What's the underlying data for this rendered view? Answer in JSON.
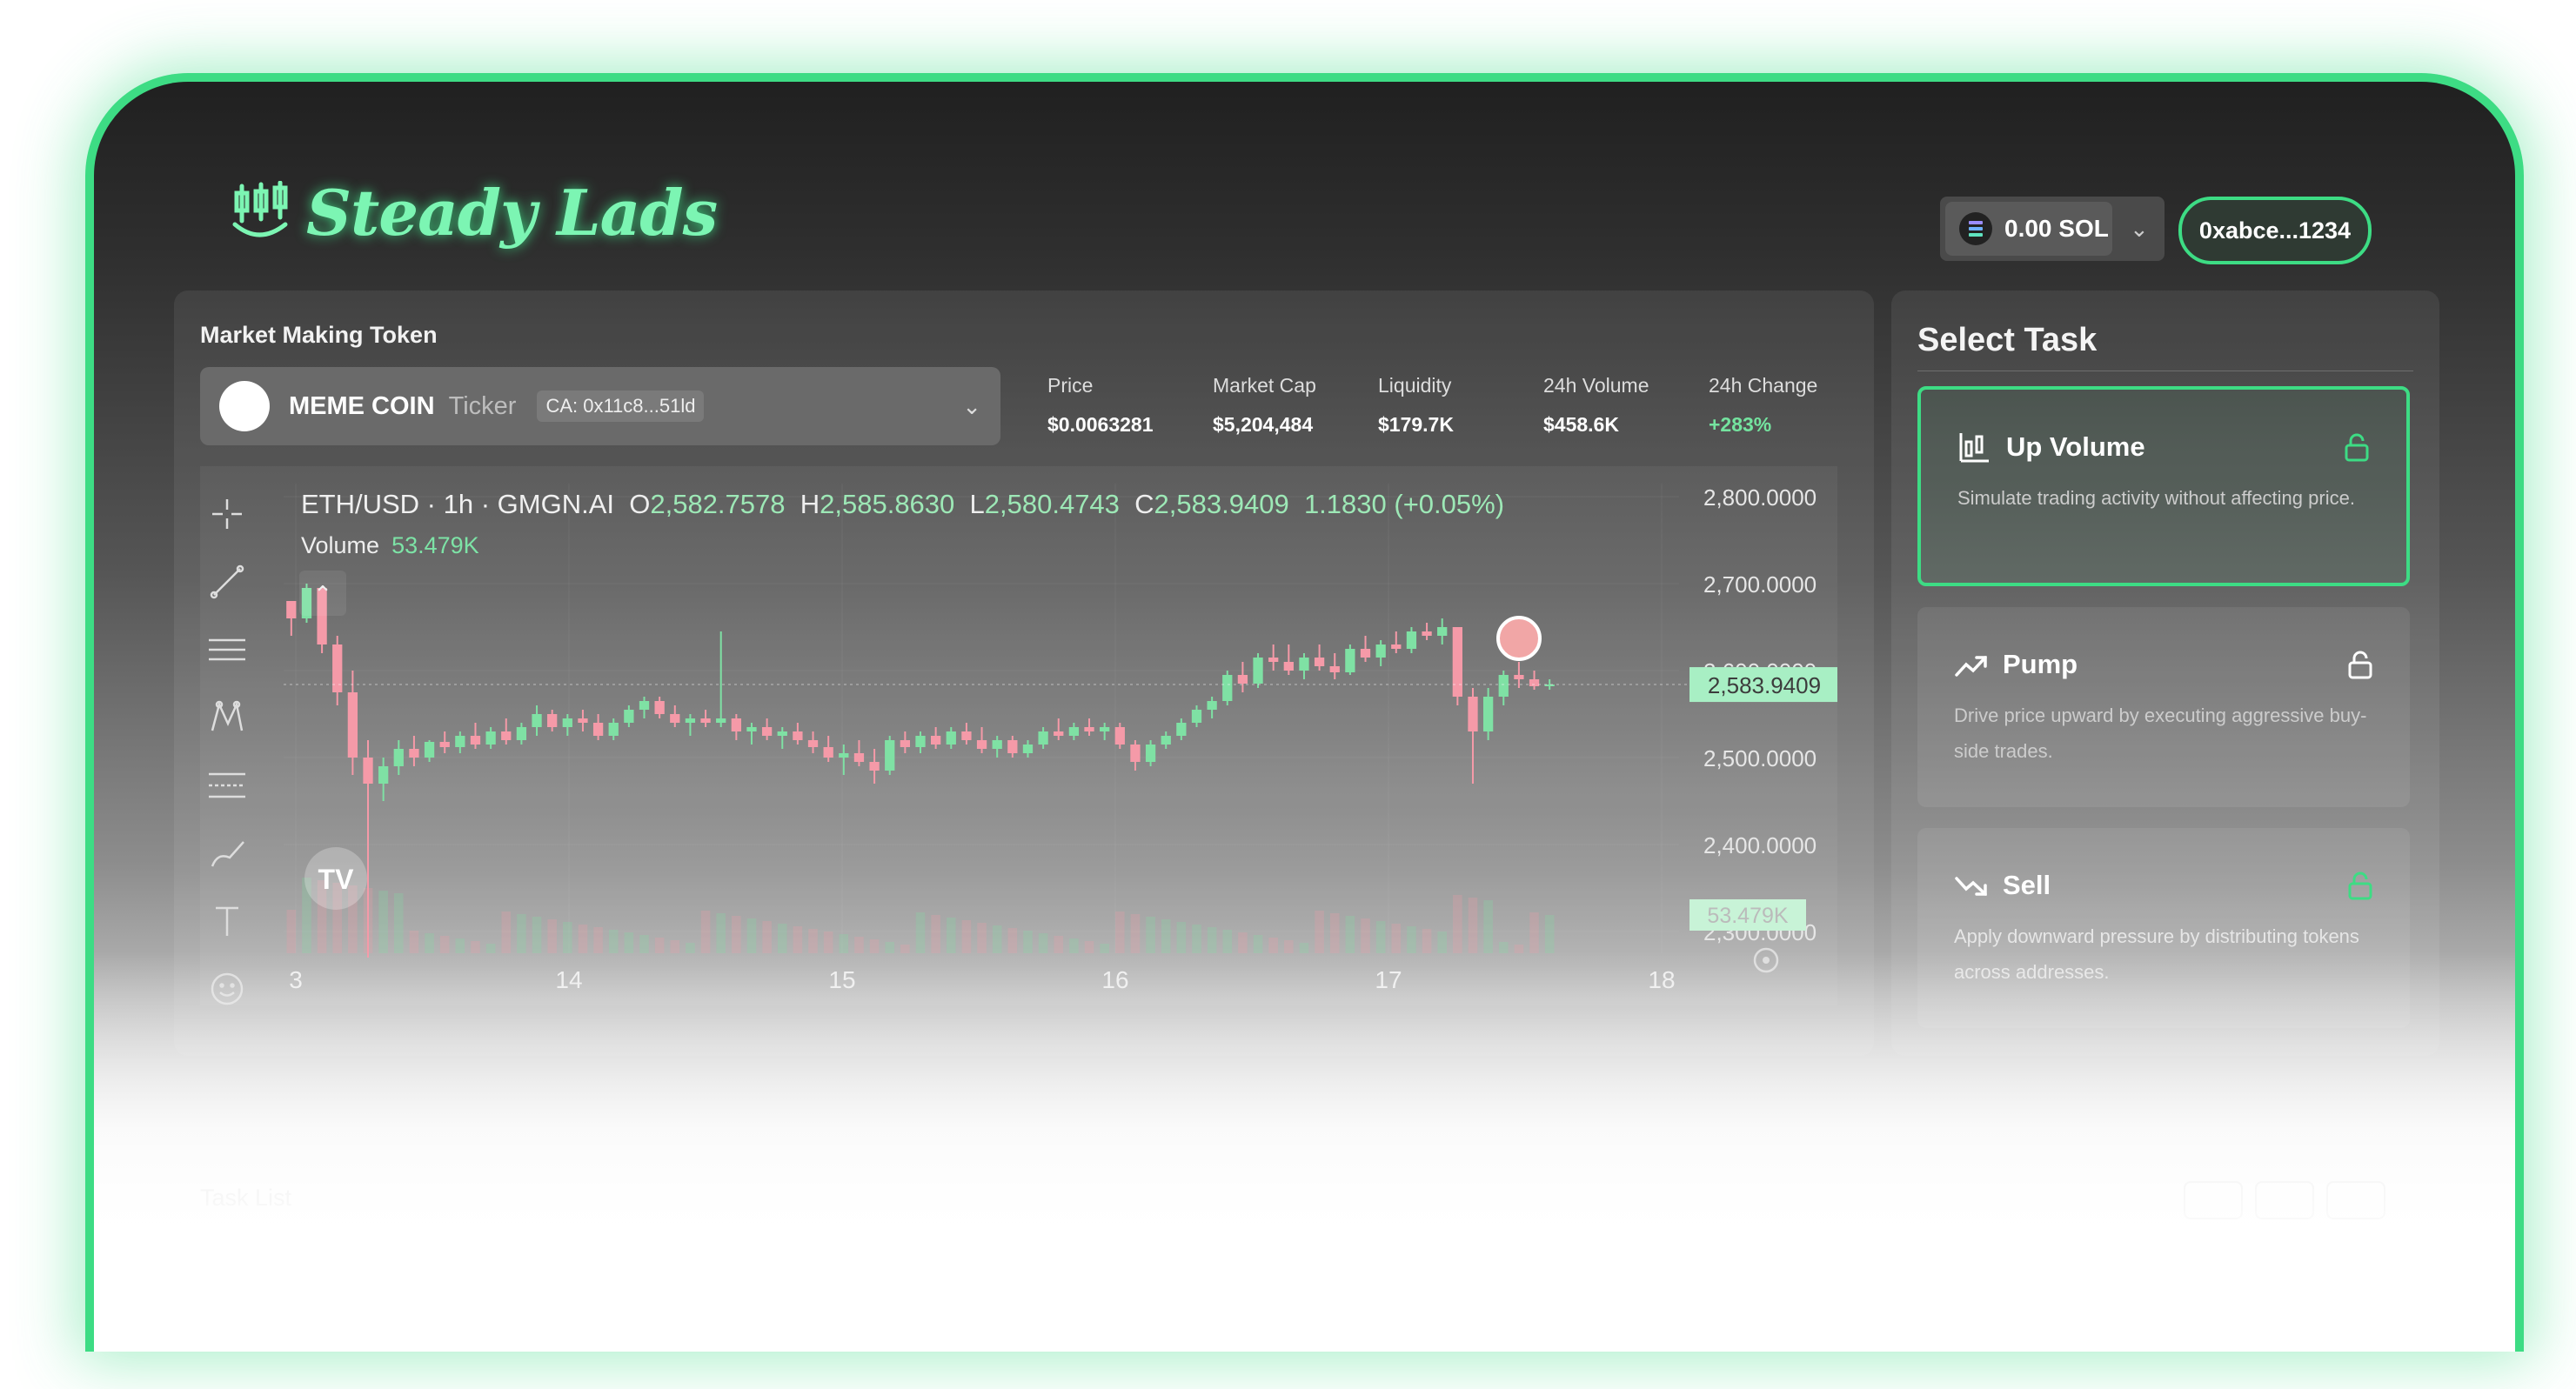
{
  "brand": {
    "name": "Steady Lads"
  },
  "header": {
    "sol_balance": "0.00 SOL",
    "wallet_address": "0xabce...1234"
  },
  "market": {
    "title": "Market Making Token",
    "token": {
      "name": "MEME COIN",
      "ticker": "Ticker",
      "ca": "CA: 0x11c8...51ld"
    },
    "stats": [
      {
        "label": "Price",
        "value": "$0.0063281"
      },
      {
        "label": "Market Cap",
        "value": "$5,204,484"
      },
      {
        "label": "Liquidity",
        "value": "$179.7K"
      },
      {
        "label": "24h Volume",
        "value": "$458.6K"
      },
      {
        "label": "24h Change",
        "value": "+283%"
      }
    ]
  },
  "chart": {
    "symbol": "ETH/USD · 1h · GMGN.AI",
    "open_label": "O",
    "open": "2,582.7578",
    "high_label": "H",
    "high": "2,585.8630",
    "low_label": "L",
    "low": "2,580.4743",
    "close_label": "C",
    "close": "2,583.9409",
    "change": "1.1830 (+0.05%)",
    "volume_label": "Volume",
    "volume_value": "53.479K",
    "current_price_tag": "2,583.9409",
    "volume_tag": "53.479K",
    "y_ticks": [
      "2,800.0000",
      "2,700.0000",
      "2,600.0000",
      "2,500.0000",
      "2,400.0000",
      "2,300.0000"
    ],
    "x_ticks": [
      "3",
      "14",
      "15",
      "16",
      "17",
      "18"
    ],
    "watermark": "TV"
  },
  "chart_data": {
    "type": "candlestick",
    "title": "ETH/USD · 1h · GMGN.AI",
    "x_ticks": [
      "3",
      "14",
      "15",
      "16",
      "17",
      "18"
    ],
    "ylim": [
      2275,
      2835
    ],
    "y_ticks": [
      2800,
      2700,
      2600,
      2500,
      2400,
      2300
    ],
    "last_close": 2583.9409,
    "candles": [
      [
        2680,
        2680,
        2640,
        2660
      ],
      [
        2660,
        2700,
        2655,
        2695
      ],
      [
        2695,
        2690,
        2620,
        2630
      ],
      [
        2630,
        2640,
        2560,
        2575
      ],
      [
        2575,
        2600,
        2480,
        2500
      ],
      [
        2500,
        2520,
        2270,
        2470
      ],
      [
        2470,
        2500,
        2450,
        2490
      ],
      [
        2490,
        2520,
        2480,
        2510
      ],
      [
        2510,
        2525,
        2490,
        2500
      ],
      [
        2500,
        2520,
        2495,
        2518
      ],
      [
        2518,
        2530,
        2505,
        2512
      ],
      [
        2512,
        2530,
        2505,
        2525
      ],
      [
        2525,
        2540,
        2510,
        2515
      ],
      [
        2515,
        2535,
        2510,
        2530
      ],
      [
        2530,
        2545,
        2515,
        2520
      ],
      [
        2520,
        2540,
        2515,
        2535
      ],
      [
        2535,
        2560,
        2525,
        2550
      ],
      [
        2550,
        2555,
        2530,
        2535
      ],
      [
        2535,
        2550,
        2525,
        2545
      ],
      [
        2545,
        2555,
        2530,
        2540
      ],
      [
        2540,
        2550,
        2520,
        2525
      ],
      [
        2525,
        2545,
        2520,
        2540
      ],
      [
        2540,
        2560,
        2535,
        2555
      ],
      [
        2555,
        2570,
        2545,
        2565
      ],
      [
        2565,
        2570,
        2545,
        2550
      ],
      [
        2550,
        2560,
        2535,
        2540
      ],
      [
        2540,
        2550,
        2525,
        2545
      ],
      [
        2545,
        2555,
        2535,
        2540
      ],
      [
        2540,
        2645,
        2535,
        2545
      ],
      [
        2545,
        2550,
        2520,
        2530
      ],
      [
        2530,
        2540,
        2515,
        2535
      ],
      [
        2535,
        2545,
        2520,
        2525
      ],
      [
        2525,
        2535,
        2510,
        2530
      ],
      [
        2530,
        2540,
        2515,
        2520
      ],
      [
        2520,
        2530,
        2505,
        2512
      ],
      [
        2512,
        2525,
        2495,
        2500
      ],
      [
        2500,
        2515,
        2480,
        2505
      ],
      [
        2505,
        2520,
        2490,
        2495
      ],
      [
        2495,
        2510,
        2470,
        2485
      ],
      [
        2485,
        2525,
        2480,
        2520
      ],
      [
        2520,
        2530,
        2505,
        2512
      ],
      [
        2512,
        2530,
        2505,
        2525
      ],
      [
        2525,
        2535,
        2510,
        2515
      ],
      [
        2515,
        2535,
        2510,
        2530
      ],
      [
        2530,
        2540,
        2515,
        2520
      ],
      [
        2520,
        2535,
        2505,
        2510
      ],
      [
        2510,
        2525,
        2500,
        2520
      ],
      [
        2520,
        2525,
        2500,
        2505
      ],
      [
        2505,
        2520,
        2500,
        2515
      ],
      [
        2515,
        2535,
        2510,
        2530
      ],
      [
        2530,
        2545,
        2520,
        2525
      ],
      [
        2525,
        2540,
        2520,
        2535
      ],
      [
        2535,
        2545,
        2525,
        2530
      ],
      [
        2530,
        2540,
        2520,
        2535
      ],
      [
        2535,
        2540,
        2510,
        2515
      ],
      [
        2515,
        2520,
        2485,
        2495
      ],
      [
        2495,
        2520,
        2490,
        2515
      ],
      [
        2515,
        2530,
        2510,
        2525
      ],
      [
        2525,
        2545,
        2520,
        2540
      ],
      [
        2540,
        2560,
        2535,
        2555
      ],
      [
        2555,
        2570,
        2545,
        2565
      ],
      [
        2565,
        2600,
        2560,
        2595
      ],
      [
        2595,
        2610,
        2575,
        2585
      ],
      [
        2585,
        2620,
        2580,
        2615
      ],
      [
        2615,
        2630,
        2600,
        2610
      ],
      [
        2610,
        2630,
        2595,
        2600
      ],
      [
        2600,
        2620,
        2590,
        2615
      ],
      [
        2615,
        2630,
        2600,
        2605
      ],
      [
        2605,
        2620,
        2590,
        2598
      ],
      [
        2598,
        2630,
        2595,
        2625
      ],
      [
        2625,
        2640,
        2610,
        2615
      ],
      [
        2615,
        2635,
        2605,
        2630
      ],
      [
        2630,
        2645,
        2620,
        2625
      ],
      [
        2625,
        2650,
        2620,
        2645
      ],
      [
        2645,
        2655,
        2635,
        2640
      ],
      [
        2640,
        2660,
        2630,
        2650
      ],
      [
        2650,
        2650,
        2560,
        2570
      ],
      [
        2570,
        2580,
        2470,
        2530
      ],
      [
        2530,
        2580,
        2520,
        2570
      ],
      [
        2570,
        2600,
        2560,
        2595
      ],
      [
        2595,
        2610,
        2580,
        2590
      ],
      [
        2590,
        2600,
        2578,
        2582
      ],
      [
        2582,
        2590,
        2578,
        2584
      ]
    ]
  },
  "tasks": {
    "title": "Select Task",
    "items": [
      {
        "name": "Up Volume",
        "desc": "Simulate trading activity without affecting price.",
        "icon": "chart-bars-icon",
        "active": true
      },
      {
        "name": "Pump",
        "desc": "Drive price upward by executing aggressive buy-side trades.",
        "icon": "trending-up-icon",
        "active": false
      },
      {
        "name": "Sell",
        "desc": "Apply downward pressure by distributing tokens across addresses.",
        "icon": "trending-down-icon",
        "active": false
      }
    ]
  },
  "task_list": {
    "title": "Task List"
  },
  "colors": {
    "accent": "#3ddc84",
    "up": "#7fe1a4",
    "down": "#f59aa8"
  }
}
